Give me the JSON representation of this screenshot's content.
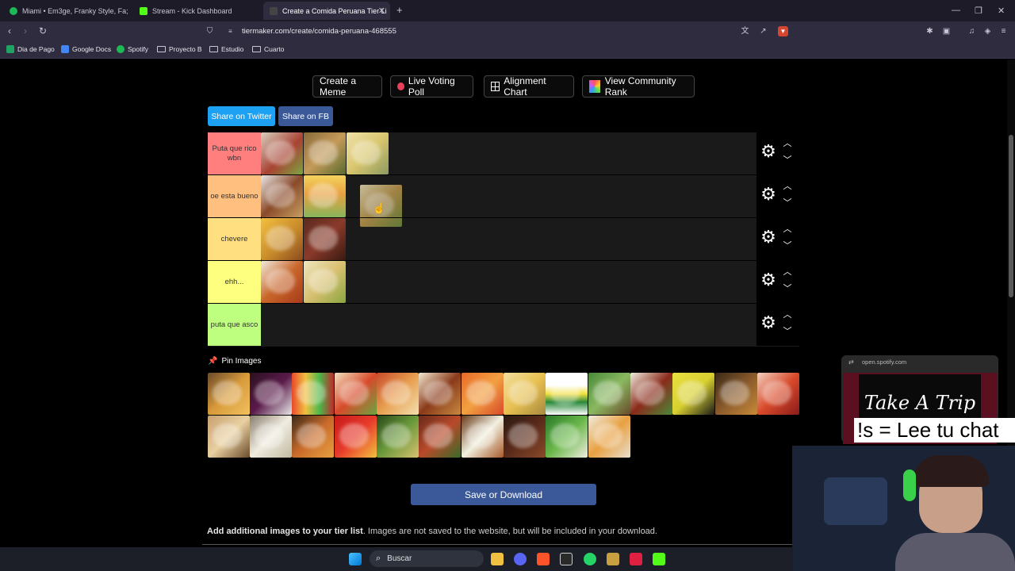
{
  "browser": {
    "tabs": [
      {
        "title": "Miami • Em3ge, Franky Style, Fa;",
        "favicon_color": "#1db954"
      },
      {
        "title": "Stream - Kick Dashboard",
        "favicon_color": "#53fc18"
      },
      {
        "title": "Create a Comida Peruana Tier Li",
        "favicon_color": "#444444"
      }
    ],
    "url": "tiermaker.com/create/comida-peruana-468555",
    "bookmarks": [
      "Dia de Pago",
      "Google Docs",
      "Spotify",
      "Proyecto B",
      "Estudio",
      "Cuarto"
    ]
  },
  "page": {
    "top_buttons": {
      "create_meme": "Create a Meme",
      "live_voting": "Live Voting Poll",
      "alignment_chart": "Alignment Chart",
      "community_rank": "View Community Rank"
    },
    "share": {
      "twitter": "Share on Twitter",
      "fb": "Share on FB"
    },
    "tiers": [
      {
        "label": "Puta que rico wbn",
        "color": "#ff7f7f",
        "items": 3
      },
      {
        "label": "oe esta bueno",
        "color": "#ffbf7f",
        "items": 2
      },
      {
        "label": "chevere",
        "color": "#ffdf7f",
        "items": 2
      },
      {
        "label": "ehh...",
        "color": "#ffff7f",
        "items": 2
      },
      {
        "label": "puta que asco",
        "color": "#bfff7f",
        "items": 0
      }
    ],
    "pin_images_label": "Pin Images",
    "pool_count": 28,
    "save_button": "Save or Download",
    "add_images_bold": "Add additional images to your tier list",
    "add_images_rest": ". Images are not saved to the website, but will be included in your download."
  },
  "overlay": {
    "spotify_source": "open.spotify.com",
    "album_art_text": "Take A Trip",
    "chat_command": "!s = Lee tu chat"
  },
  "taskbar": {
    "search_label": "Buscar"
  }
}
